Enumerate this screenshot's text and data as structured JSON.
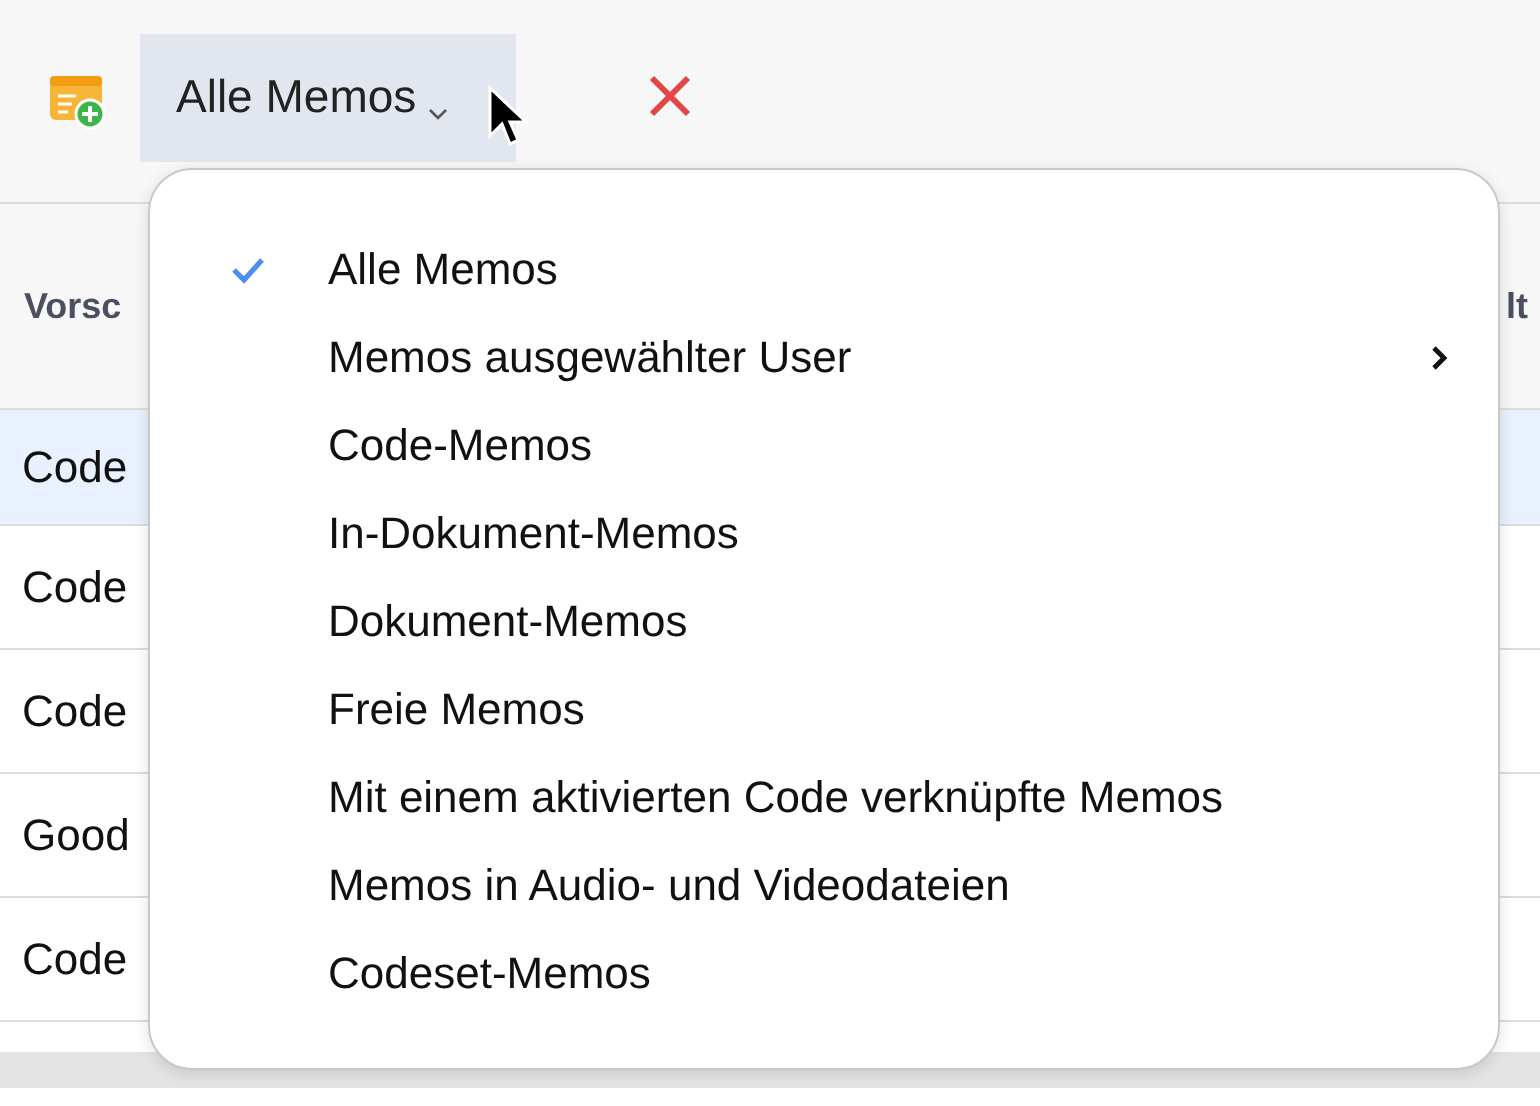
{
  "toolbar": {
    "filter": {
      "label": "Alle Memos"
    }
  },
  "table": {
    "columns": [
      "Vorsc",
      "lt"
    ],
    "rows": [
      {
        "cell": "Code",
        "selected": true
      },
      {
        "cell": "Code",
        "selected": false
      },
      {
        "cell": "Code",
        "selected": false
      },
      {
        "cell": "Good",
        "selected": false
      },
      {
        "cell": "Code",
        "selected": false
      }
    ]
  },
  "menu": {
    "items": [
      {
        "label": "Alle Memos",
        "checked": true,
        "submenu": false
      },
      {
        "label": "Memos ausgewählter User",
        "checked": false,
        "submenu": true
      },
      {
        "label": "Code-Memos",
        "checked": false,
        "submenu": false
      },
      {
        "label": "In-Dokument-Memos",
        "checked": false,
        "submenu": false
      },
      {
        "label": "Dokument-Memos",
        "checked": false,
        "submenu": false
      },
      {
        "label": "Freie Memos",
        "checked": false,
        "submenu": false
      },
      {
        "label": "Mit einem aktivierten Code verknüpfte Memos",
        "checked": false,
        "submenu": false
      },
      {
        "label": "Memos in Audio- und Videodateien",
        "checked": false,
        "submenu": false
      },
      {
        "label": "Codeset-Memos",
        "checked": false,
        "submenu": false
      }
    ]
  }
}
